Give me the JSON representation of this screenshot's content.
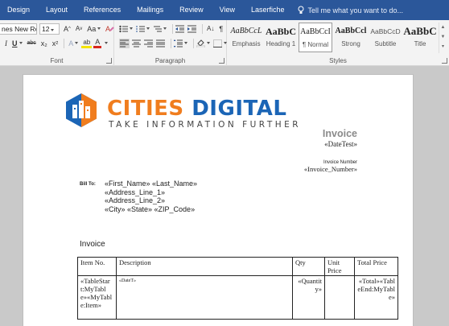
{
  "tabs": [
    "Design",
    "Layout",
    "References",
    "Mailings",
    "Review",
    "View",
    "Laserfiche"
  ],
  "tell_me": "Tell me what you want to do...",
  "font_group": {
    "font_name": "nes New Ro",
    "font_size": "12",
    "grow": "A",
    "shrink": "A",
    "change_case": "Aa",
    "bold": "I",
    "underline": "U",
    "strike": "abc",
    "subscript": "x₂",
    "superscript": "x²",
    "effects": "A",
    "highlight": "ab",
    "font_color": "A",
    "label": "Font"
  },
  "paragraph_group": {
    "label": "Paragraph",
    "sort": "A↓",
    "pilcrow": "¶"
  },
  "styles_group": {
    "label": "Styles",
    "items": [
      {
        "sample": "AaBbCcL",
        "name": "Emphasis"
      },
      {
        "sample": "AaBbC",
        "name": "Heading 1"
      },
      {
        "sample": "AaBbCcI",
        "name": "¶ Normal"
      },
      {
        "sample": "AaBbCcl",
        "name": "Strong"
      },
      {
        "sample": "AaBbCcD",
        "name": "Subtitle"
      },
      {
        "sample": "AaBbC",
        "name": "Title"
      }
    ]
  },
  "document": {
    "brand_part1": "CITIES",
    "brand_part2": "DIGITAL",
    "tagline": "TAKE INFORMATION FURTHER",
    "invoice_title": "Invoice",
    "date_field": "«DateTest»",
    "invoice_number_label": "Invoice Number",
    "invoice_number_field": "«Invoice_Number»",
    "bill_to_label": "Bill To:",
    "bill_to_lines": [
      "«First_Name» «Last_Name»",
      "«Address_Line_1»",
      "«Address_Line_2»",
      "«City» «State» «ZIP_Code»"
    ],
    "section_label": "Invoice",
    "table": {
      "headers": [
        "Item No.",
        "Description",
        "Qty",
        "Unit Price",
        "Total Price"
      ],
      "row": [
        "«TableStart:MyTable»«MyTable:Item»",
        "«DateT»",
        "«Quantity»",
        "",
        "«Total»«TableEnd:MyTable»"
      ]
    }
  },
  "colors": {
    "ribbon_tab_bar": "#2b579a",
    "brand_orange": "#f07d1e",
    "brand_blue": "#1b65b6",
    "invoice_title_gray": "#8a8a8a"
  }
}
